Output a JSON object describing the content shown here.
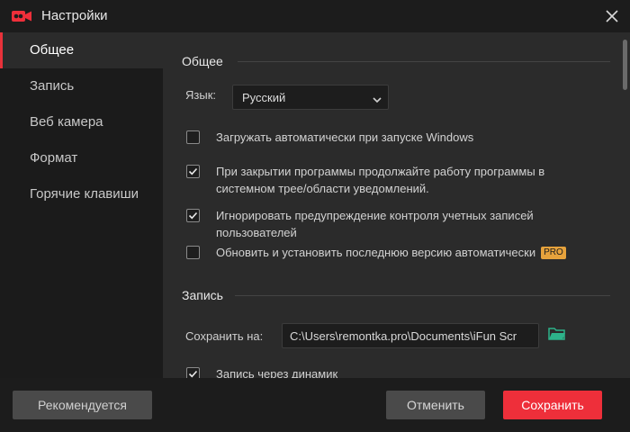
{
  "window": {
    "title": "Настройки"
  },
  "sidebar": {
    "items": [
      {
        "label": "Общее",
        "active": true
      },
      {
        "label": "Запись",
        "active": false
      },
      {
        "label": "Веб камера",
        "active": false
      },
      {
        "label": "Формат",
        "active": false
      },
      {
        "label": "Горячие клавиши",
        "active": false
      }
    ]
  },
  "general": {
    "section_title": "Общее",
    "language_label": "Язык:",
    "language_value": "Русский",
    "options": [
      {
        "text": "Загружать автоматически при запуске Windows",
        "checked": false
      },
      {
        "text": "При закрытии программы продолжайте работу программы в системном трее/области уведомлений.",
        "checked": true
      },
      {
        "text": "Игнорировать предупреждение контроля учетных записей пользователей",
        "checked": true
      },
      {
        "text": "Обновить и установить последнюю версию автоматически",
        "checked": false,
        "badge": "PRO"
      }
    ]
  },
  "record": {
    "section_title": "Запись",
    "save_label": "Сохранить на:",
    "save_path": "C:\\Users\\remontka.pro\\Documents\\iFun Scr",
    "speaker_option": {
      "text": "Запись через динамик",
      "checked": true
    }
  },
  "footer": {
    "recommend_label": "Рекомендуется",
    "cancel_label": "Отменить",
    "save_label": "Сохранить"
  },
  "colors": {
    "accent": "#ee2f3a",
    "pro_badge": "#e6a23c",
    "folder_icon": "#2db38a"
  },
  "icons": {
    "app": "video-camera-icon",
    "close": "close-icon",
    "dropdown": "chevron-down-icon",
    "checkbox": "checkmark-icon",
    "folder": "folder-icon"
  }
}
